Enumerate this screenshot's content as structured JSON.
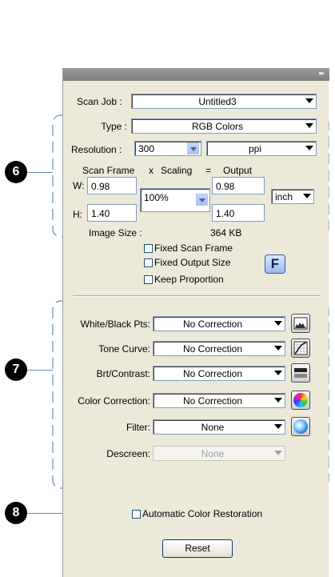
{
  "titlebar": {
    "grip_icon": "double-chevron-right"
  },
  "scan_job": {
    "label": "Scan Job :",
    "value": "Untitled3"
  },
  "type": {
    "label": "Type :",
    "value": "RGB Colors"
  },
  "resolution": {
    "label": "Resolution :",
    "value": "300",
    "unit": "ppi"
  },
  "frame_header": {
    "scan_frame": "Scan Frame",
    "x": "x",
    "scaling": "Scaling",
    "eq": "=",
    "output": "Output"
  },
  "scan_frame": {
    "w_label": "W:",
    "w": "0.98",
    "h_label": "H:",
    "h": "1.40"
  },
  "scaling": {
    "value": "100%"
  },
  "output": {
    "w": "0.98",
    "h": "1.40",
    "unit": "inch"
  },
  "image_size": {
    "label": "Image Size :",
    "value": "364 KB"
  },
  "options": {
    "fixed_scan_frame": {
      "label": "Fixed Scan Frame",
      "checked": false
    },
    "fixed_output_size": {
      "label": "Fixed Output Size",
      "checked": false
    },
    "keep_proportion": {
      "label": "Keep Proportion",
      "checked": false
    },
    "f_button": "F"
  },
  "corrections": [
    {
      "label": "White/Black Pts:",
      "value": "No Correction",
      "icon": "histogram-icon"
    },
    {
      "label": "Tone Curve:",
      "value": "No Correction",
      "icon": "tone-curve-icon"
    },
    {
      "label": "Brt/Contrast:",
      "value": "No Correction",
      "icon": "brightness-contrast-icon"
    },
    {
      "label": "Color Correction:",
      "value": "No Correction",
      "icon": "color-wheel-icon"
    },
    {
      "label": "Filter:",
      "value": "None",
      "icon": "filter-icon"
    },
    {
      "label": "Descreen:",
      "value": "None",
      "disabled": true
    }
  ],
  "auto_color_restoration": {
    "label": "Automatic Color Restoration",
    "checked": false
  },
  "reset": {
    "label": "Reset"
  },
  "callouts": [
    "6",
    "7",
    "8"
  ],
  "colors": {
    "panel_bg": "#ece9d8",
    "callout_line": "#5a8ec8",
    "combo_border": "#7f9db9"
  }
}
